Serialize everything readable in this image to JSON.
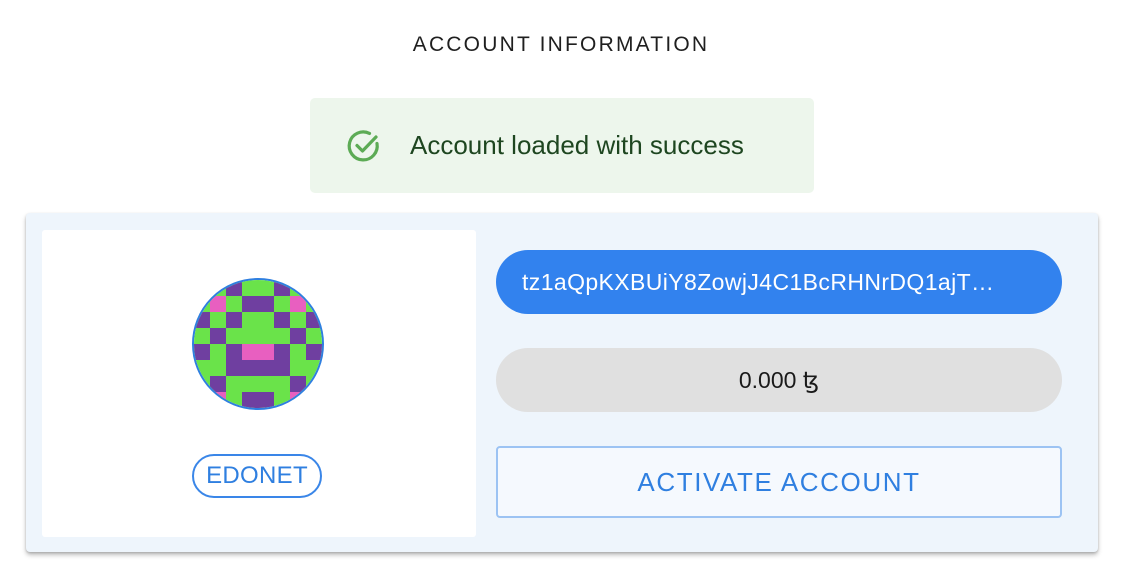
{
  "header": {
    "title": "ACCOUNT INFORMATION"
  },
  "alert": {
    "icon": "check-circle-icon",
    "message": "Account loaded with success",
    "color": "#1e4620",
    "icon_color": "#5cab55",
    "background": "#edf6ec"
  },
  "account": {
    "avatar": "identicon",
    "identicon_colors": {
      "primary": "#6ae34a",
      "secondary": "#6f3fa0",
      "accent": "#e85fc0"
    },
    "network": "EDONET",
    "address": "tz1aQpKXBUiY8ZowjJ4C1BcRHNrDQ1ajT…",
    "balance": "0.000 ꜩ",
    "activate_label": "ACTIVATE ACCOUNT"
  },
  "colors": {
    "accent": "#3282ee",
    "card_background": "#eef5fc",
    "balance_background": "#e0e0e0"
  }
}
